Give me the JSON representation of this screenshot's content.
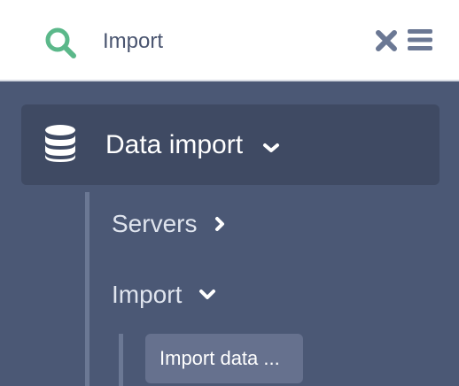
{
  "search": {
    "query": "Import",
    "icon": "search-icon",
    "accent_color": "#5bb88a"
  },
  "toolbar": {
    "close_icon": "close-icon",
    "menu_icon": "hamburger-menu-icon",
    "icon_color": "#6b7894"
  },
  "sidebar": {
    "group": {
      "label": "Data import",
      "icon": "database-icon",
      "expanded": true
    },
    "items": [
      {
        "label": "Servers",
        "expanded": false,
        "chevron": "chevron-right-icon"
      },
      {
        "label": "Import",
        "expanded": true,
        "chevron": "chevron-down-icon",
        "children": [
          {
            "label": "Import data ...",
            "selected": true
          }
        ]
      }
    ]
  }
}
